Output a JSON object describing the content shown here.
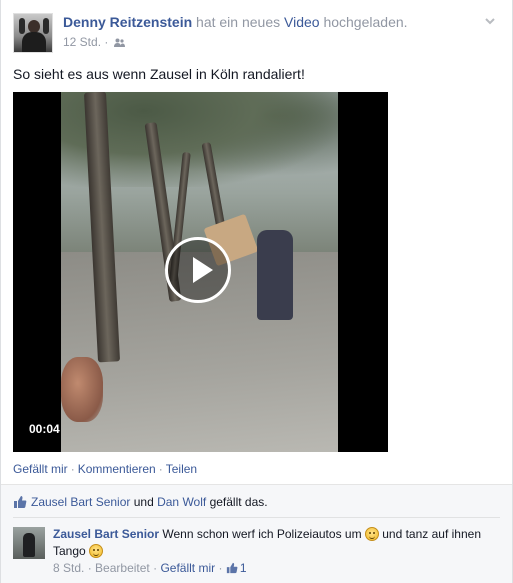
{
  "post": {
    "author": "Denny Reitzenstein",
    "action_prefix": " hat ein neues ",
    "action_link": "Video",
    "action_suffix": " hochgeladen.",
    "time": "12 Std. · ",
    "audience_icon": "friends-icon",
    "text": "So sieht es aus wenn Zausel in Köln randaliert!",
    "menu_icon": "chevron-down-icon"
  },
  "video": {
    "duration": "00:04",
    "play_icon": "play-icon"
  },
  "actions": {
    "like": "Gefällt mir",
    "comment": "Kommentieren",
    "share": "Teilen",
    "separator": "·"
  },
  "likes": {
    "name1": "Zausel Bart Senior",
    "conj": " und ",
    "name2": "Dan Wolf",
    "suffix": " gefällt das."
  },
  "comment": {
    "author": "Zausel Bart Senior",
    "text_part1": " Wenn schon werf ich Polizeiautos um ",
    "text_part2": " und tanz auf ihnen Tango ",
    "time": "8 Std.",
    "edited": "Bearbeitet",
    "like": "Gefällt mir",
    "like_count": "1",
    "separator": "·"
  },
  "colors": {
    "link": "#3b5998",
    "muted": "#9197a3",
    "text": "#141823",
    "feedback_bg": "#f6f7f9"
  }
}
